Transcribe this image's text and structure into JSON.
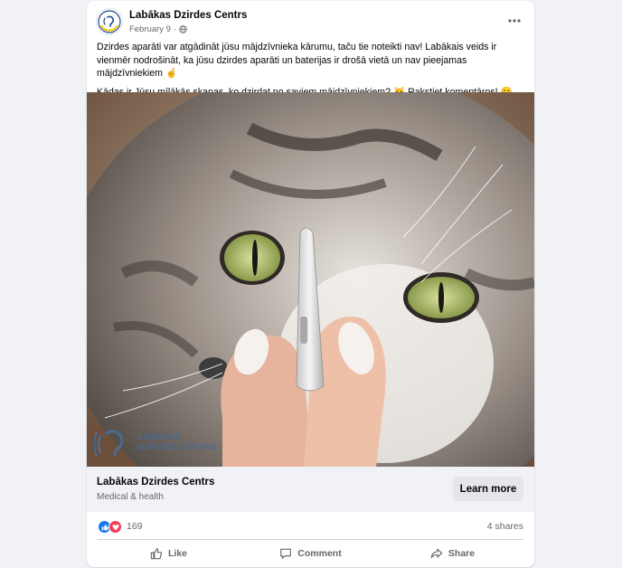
{
  "post": {
    "page_name": "Labākas Dzirdes Centrs",
    "date": "February 9",
    "separator": "·",
    "privacy_icon": "globe-icon",
    "more_icon": "ellipsis-icon",
    "text_paragraph_1": "Dzirdes aparāti var atgādināt jūsu mājdzīvnieka kārumu, taču tie noteikti nav! Labākais veids ir vienmēr nodrošināt, ka jūsu dzirdes aparāti un baterijas ir drošā vietā un nav pieejamas mājdzīvniekiem ☝️",
    "text_paragraph_2": "Kādas ir Jūsu mīļākās skaņas, ko dzirdat no saviem mājdzīvniekiem? 🐱 Rakstiet komentāros! 😊"
  },
  "photo": {
    "watermark_line_1": "LABĀKAS",
    "watermark_line_2": "DZIRDES CENTRS",
    "watermark_icon": "ear-logo-icon"
  },
  "link_preview": {
    "title": "Labākas Dzirdes Centrs",
    "subtitle": "Medical & health",
    "button_label": "Learn more"
  },
  "engagement": {
    "reaction_icons": [
      "like-icon",
      "love-icon"
    ],
    "reaction_count": "169",
    "shares": "4 shares"
  },
  "actions": {
    "like_label": "Like",
    "comment_label": "Comment",
    "share_label": "Share"
  },
  "colors": {
    "like_blue": "#1877f2",
    "love_red": "#f33e58",
    "brand_blue": "#4a6a8f",
    "brand_yellow": "#f7c600"
  }
}
